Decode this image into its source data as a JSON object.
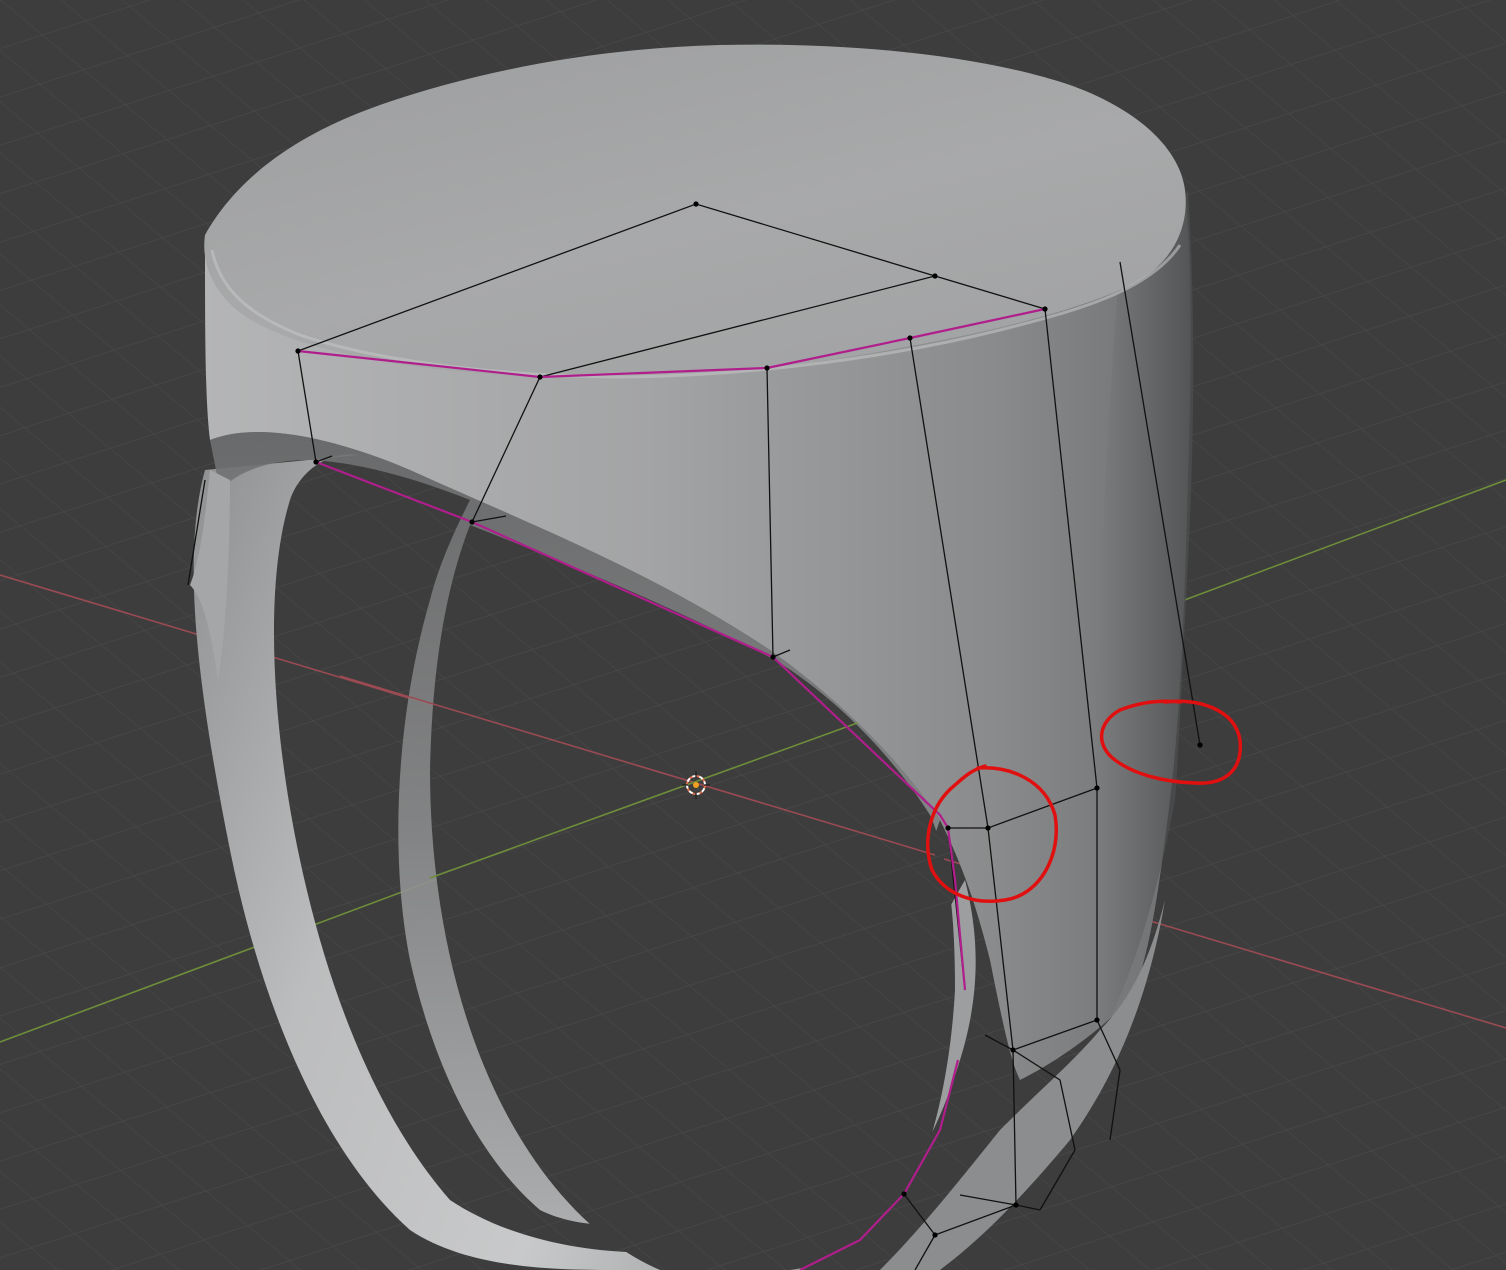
{
  "app": {
    "title": ""
  },
  "viewport": {
    "mode": "3D Viewport",
    "background_color": "#3d3d3d",
    "grid_color": "#4a4a4a",
    "x_axis_color": "#9a4a52",
    "y_axis_color": "#6e8e3a"
  },
  "object": {
    "name": "",
    "type": "signet-ring",
    "shading": "solid",
    "surface_color": "#a9aaab",
    "cage_edge_color": "#111111",
    "seam_edge_color": "#b01e8c"
  },
  "annotations": {
    "marker_color": "#e01010",
    "circles": [
      {
        "label": ""
      },
      {
        "label": ""
      }
    ]
  },
  "icons": {
    "origin": "origin-point-icon",
    "cursor": "3d-cursor-icon"
  }
}
